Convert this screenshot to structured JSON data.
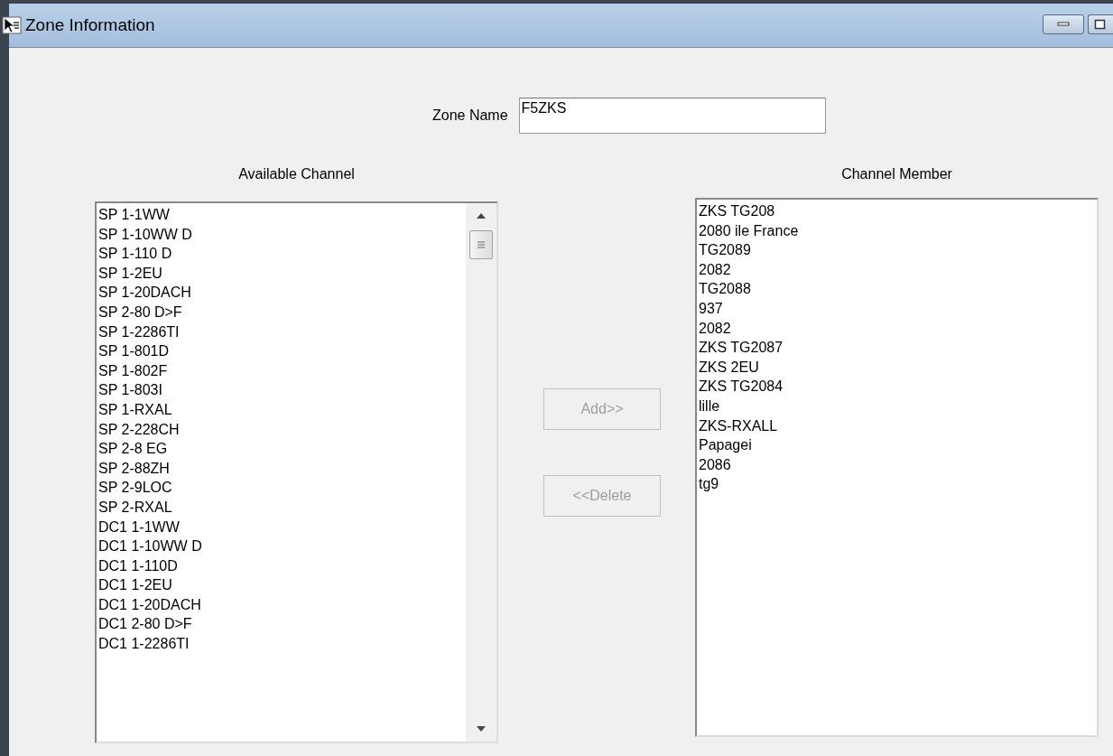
{
  "window": {
    "title": "Zone Information"
  },
  "zone_name": {
    "label": "Zone Name",
    "value": "F5ZKS"
  },
  "available": {
    "label": "Available Channel",
    "items": [
      "SP 1-1WW",
      "SP 1-10WW D",
      "SP 1-110 D",
      "SP 1-2EU",
      "SP 1-20DACH",
      "SP 2-80 D>F",
      "SP 1-2286TI",
      "SP 1-801D",
      "SP 1-802F",
      "SP 1-803I",
      "SP 1-RXAL",
      "SP 2-228CH",
      "SP 2-8 EG",
      "SP 2-88ZH",
      "SP 2-9LOC",
      "SP 2-RXAL",
      "DC1 1-1WW",
      "DC1 1-10WW D",
      "DC1 1-110D",
      "DC1 1-2EU",
      "DC1 1-20DACH",
      "DC1 2-80 D>F",
      "DC1 1-2286TI"
    ]
  },
  "buttons": [
    {
      "label": "Add>>",
      "disabled": true
    },
    {
      "label": "<<Delete",
      "disabled": true
    }
  ],
  "members": {
    "label": "Channel Member",
    "items": [
      "ZKS TG208",
      "2080 ile France",
      "TG2089",
      "2082",
      "TG2088",
      "937",
      "2082",
      "ZKS TG2087",
      "ZKS 2EU",
      "ZKS TG2084",
      "lille",
      "ZKS-RXALL",
      "Papagei",
      "2086",
      "tg9"
    ]
  }
}
